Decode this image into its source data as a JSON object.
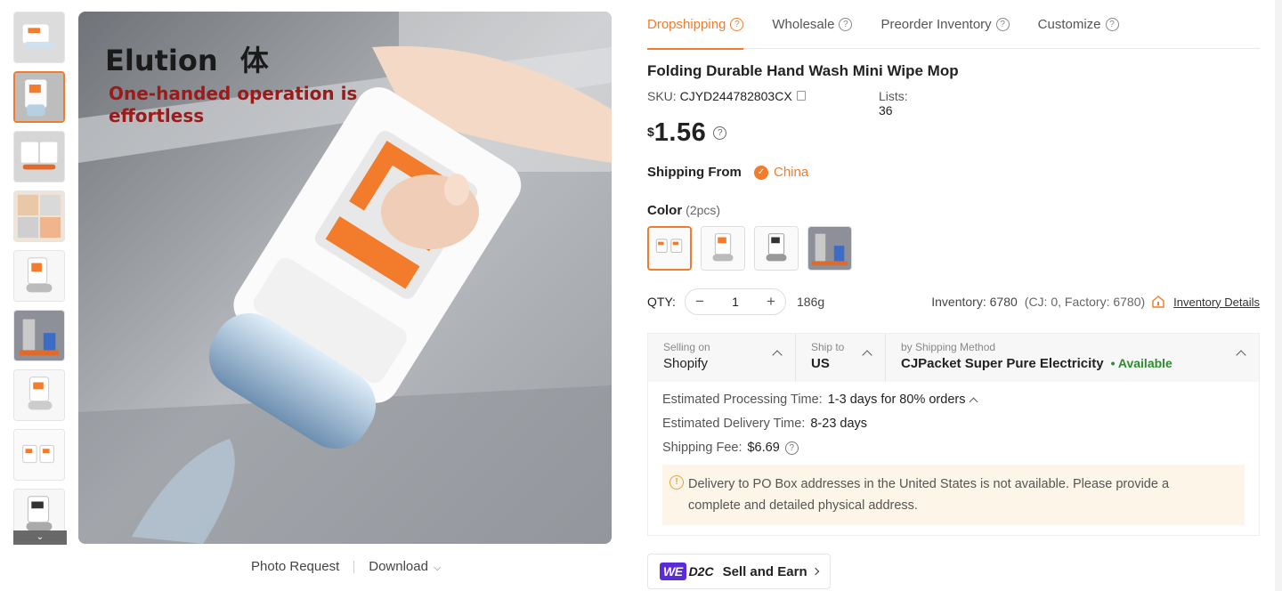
{
  "tabs": [
    {
      "label": "Dropshipping"
    },
    {
      "label": "Wholesale"
    },
    {
      "label": "Preorder Inventory"
    },
    {
      "label": "Customize"
    }
  ],
  "product": {
    "title": "Folding Durable Hand Wash Mini Wipe Mop",
    "sku_label": "SKU:",
    "sku": "CJYD244782803CX",
    "lists_label": "Lists:",
    "lists": "36",
    "currency": "$",
    "price": "1.56"
  },
  "image_overlay": {
    "title": "Elution",
    "title_cjk": "体",
    "subtitle": "One-handed operation is effortless"
  },
  "image_actions": {
    "photo_request": "Photo Request",
    "download": "Download"
  },
  "shipping_from": {
    "label": "Shipping From",
    "country": "China"
  },
  "color": {
    "label": "Color",
    "selected": "(2pcs)",
    "swatch_count": 4
  },
  "qty": {
    "label": "QTY:",
    "value": "1",
    "weight": "186g",
    "inventory_label": "Inventory:",
    "inventory": "6780",
    "inventory_breakdown": "(CJ: 0, Factory: 6780)",
    "inventory_details": "Inventory Details"
  },
  "shipping": {
    "selling_on_label": "Selling on",
    "selling_on": "Shopify",
    "ship_to_label": "Ship to",
    "ship_to": "US",
    "method_label": "by Shipping Method",
    "method": "CJPacket Super Pure Electricity",
    "availability": "• Available",
    "processing_label": "Estimated Processing Time:",
    "processing": "1-3 days for 80% orders",
    "delivery_label": "Estimated Delivery Time:",
    "delivery": "8-23 days",
    "fee_label": "Shipping Fee:",
    "fee": "$6.69",
    "notice": "Delivery to PO Box addresses in the United States is not available. Please provide a complete and detailed physical address."
  },
  "d2c": {
    "we": "WE",
    "d2c": "D2C",
    "label": "Sell and Earn"
  },
  "colors": {
    "accent": "#f27c2c",
    "available": "#2e8b2e",
    "d2c_badge": "#5b2bd8",
    "notice_bg": "#fdf6e8"
  }
}
